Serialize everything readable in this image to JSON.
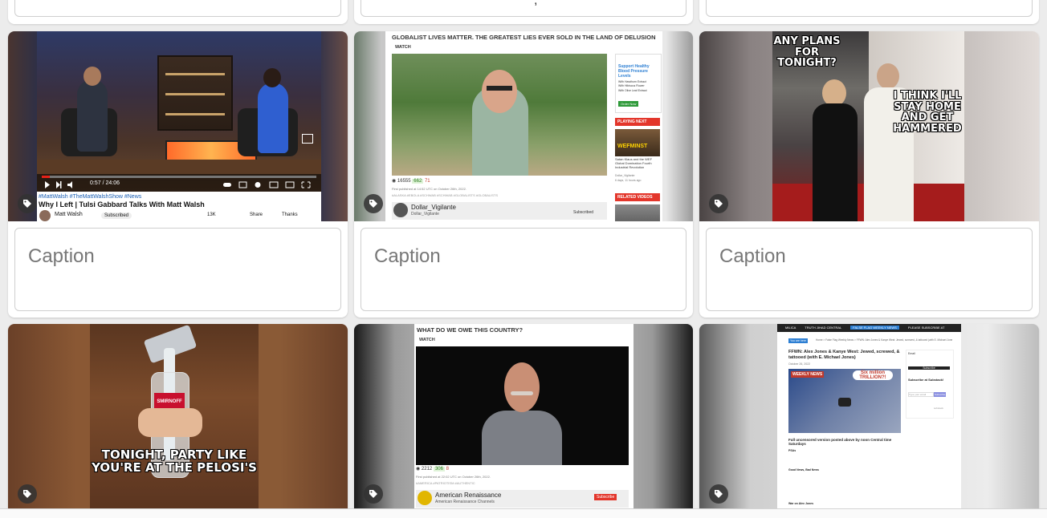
{
  "gallery": {
    "caption_placeholder": "Caption",
    "cards": [
      {
        "kind": "video-screenshot",
        "hashtags": "#MattWalsh #TheMattWalshShow #News",
        "title": "Why I Left | Tulsi Gabbard Talks With Matt Walsh",
        "channel": "Matt Walsh",
        "subscribe": "Subscribed",
        "likes": "13K",
        "share": "Share",
        "thanks": "Thanks",
        "time": "0:57 / 24:06"
      },
      {
        "kind": "bitchute-screenshot",
        "headline": "GLOBALIST LIVES MATTER. THE GREATEST LIES EVER SOLD IN THE LAND OF DELUSION",
        "watch": "WATCH",
        "views": "16555",
        "likes": "662",
        "dislikes": "71",
        "published": "First published at 14:52 UTC on October 26th, 2022.",
        "tags": "#ALASKA #EBOLA #SCHWAB #SCHWAB #GLOBALISTS #GLOBALISTS",
        "channel": "Dollar_Vigilante",
        "channel_sub": "Dollar_Vigilante",
        "subscribe": "Subscribed",
        "side_ad": "Support Healthy Blood Pressure Levels",
        "side_ad_items": [
          "With Hawthorn Extract",
          "With Hibiscus Flower",
          "With Olive Leaf Extract"
        ],
        "side_ad_button": "Order Now",
        "playing_next": "PLAYING NEXT",
        "next_title": "Satan Klaus and the WEF Global Domination Fourth Industrial Revolution",
        "next_overlay": "WEFMINST",
        "next_channel": "Dollar_Vigilante",
        "next_age": "6 days, 11 hours ago",
        "related": "RELATED VIDEOS"
      },
      {
        "kind": "meme",
        "top_text": "ANY PLANS FOR TONIGHT?",
        "side_text": "I THINK I'LL STAY HOME AND GET HAMMERED"
      },
      {
        "kind": "meme",
        "bottom_text": "TONIGHT, PARTY LIKE YOU'RE AT THE PELOSI'S",
        "bottle_label": "SMIRNOFF"
      },
      {
        "kind": "bitchute-screenshot",
        "headline": "WHAT DO WE OWE THIS COUNTRY?",
        "watch": "WATCH",
        "views": "2212",
        "likes": "306",
        "dislikes": "8",
        "published": "First published at 22:02 UTC on October 26th, 2022.",
        "tags": "#AMERICA #PATRIOTISM #AUTHENTIC",
        "channel": "American Renaissance",
        "channel_sub": "American Renaissance Channels",
        "subscribe": "Subscribe"
      },
      {
        "kind": "webpage-screenshot",
        "nav": [
          "MILICA",
          "TRUTH JIHAD CENTRAL",
          "FALSE FLAG WEEKLY NEWS",
          "PLEASE SUBSCRIBE AT SUBSTACK"
        ],
        "breadcrumb": "Home > False Flag Weekly News > FFWN: Alex Jones & Kanye West: Jewed, screwed, & tattooed (with E. Michael Jones)",
        "tag_pill": "You are here",
        "post_title": "FFWN: Alex Jones & Kanye West: Jewed, screwed, & tattooed (with E. Michael Jones)",
        "post_meta": "October 26, 2022",
        "image_overlay": "Six million TRILLION?!",
        "weekly_news": "WEEKLY NEWS",
        "post_body_title": "Full uncensored version posted above by noon Central time Saturdays",
        "post_body_sub": "PSAs",
        "side_email": "Email",
        "side_subscribe_btn": "Subscribe",
        "side_substack": "Subscribe at Substack!",
        "side_input": "Type your email",
        "side_btn": "Subscribe",
        "side_footer": "substack",
        "good_news": "Good News, Bad News",
        "war_on_jones": "War on Alex Jones"
      }
    ]
  }
}
